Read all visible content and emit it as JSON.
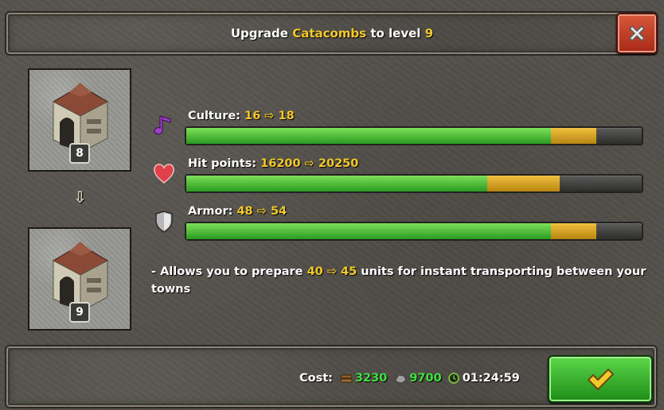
{
  "header": {
    "title_prefix": "Upgrade",
    "building_name": "Catacombs",
    "title_mid": "to level",
    "target_level": "9"
  },
  "close_button": {
    "icon": "close-icon"
  },
  "building": {
    "current_level": "8",
    "next_level": "9",
    "arrow": "⇩"
  },
  "stats": [
    {
      "label": "Culture:",
      "from": "16",
      "to": "18",
      "icon": "music-note-icon",
      "current_fraction": 0.8,
      "next_fraction": 0.9
    },
    {
      "label": "Hit points:",
      "from": "16200",
      "to": "20250",
      "icon": "heart-icon",
      "current_fraction": 0.66,
      "next_fraction": 0.82
    },
    {
      "label": "Armor:",
      "from": "48",
      "to": "54",
      "icon": "shield-icon",
      "current_fraction": 0.8,
      "next_fraction": 0.9
    }
  ],
  "arrow_glyph": "⇨",
  "description": {
    "prefix": "- Allows you to prepare",
    "from": "40",
    "to": "45",
    "suffix": "units for instant transporting between your towns"
  },
  "cost": {
    "label": "Cost:",
    "wood": "3230",
    "stone": "9700",
    "time": "01:24:59",
    "wood_icon": "wood-icon",
    "stone_icon": "stone-icon",
    "time_icon": "clock-icon"
  },
  "confirm_button": {
    "icon": "checkmark-icon"
  },
  "colors": {
    "highlight": "#f2c82a",
    "resource": "#40e040",
    "bar_current": "#3ab82a",
    "bar_next": "#d8a028",
    "close_button": "#c0401e",
    "confirm_button": "#2ea824"
  }
}
